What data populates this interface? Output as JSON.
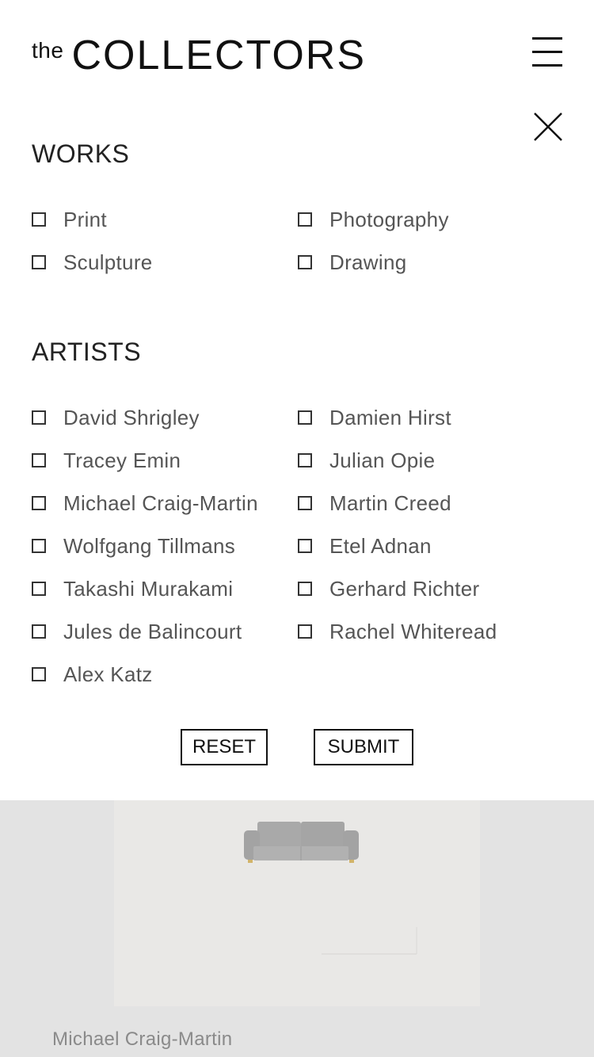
{
  "header": {
    "logo_prefix": "the",
    "logo_main": "COLLECTORS",
    "menu_icon": "hamburger-menu-icon",
    "close_icon": "close-icon"
  },
  "works": {
    "title": "WORKS",
    "options": [
      "Print",
      "Photography",
      "Sculpture",
      "Drawing"
    ]
  },
  "artists": {
    "title": "ARTISTS",
    "options": [
      "David Shrigley",
      "Damien Hirst",
      "Tracey Emin",
      "Julian Opie",
      "Michael Craig-Martin",
      "Martin Creed",
      "Wolfgang Tillmans",
      "Etel Adnan",
      "Takashi Murakami",
      "Gerhard Richter",
      "Jules de Balincourt",
      "Rachel Whiteread",
      "Alex Katz"
    ]
  },
  "actions": {
    "reset_label": "RESET",
    "submit_label": "SUBMIT"
  },
  "background": {
    "artist_name": "Michael Craig-Martin"
  }
}
